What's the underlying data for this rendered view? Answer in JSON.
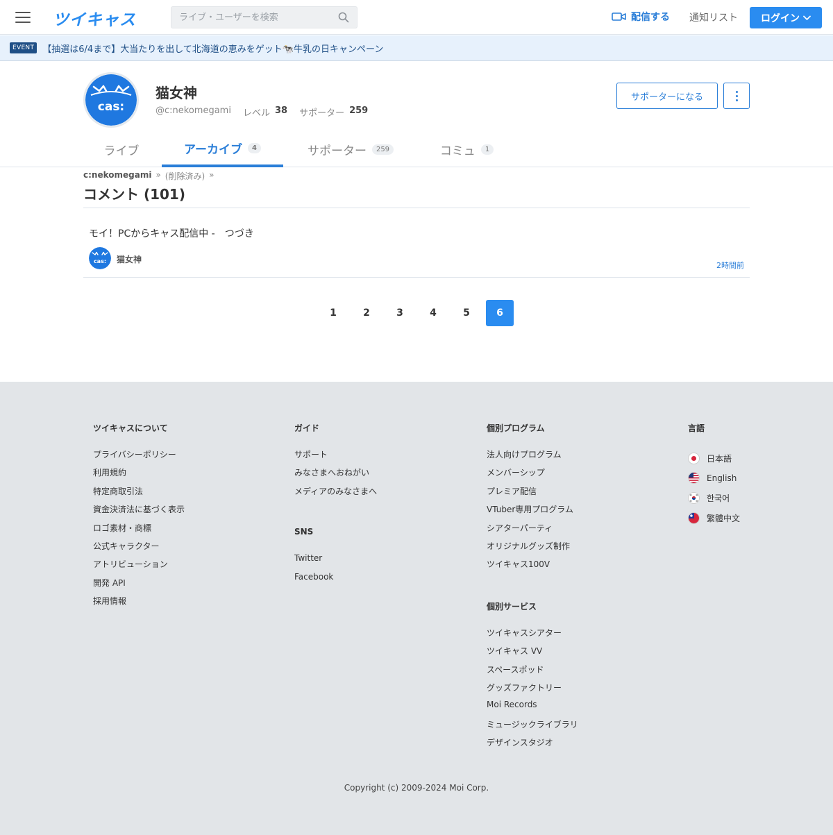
{
  "header": {
    "logo": "ツイキャス",
    "search_placeholder": "ライブ・ユーザーを検索",
    "broadcast_label": "配信する",
    "notify_label": "通知リスト",
    "login_label": "ログイン"
  },
  "event": {
    "badge": "EVENT",
    "text": "【抽選は6/4まで】大当たりを出して北海道の恵みをゲット🐄牛乳の日キャンペーン"
  },
  "profile": {
    "name": "猫女神",
    "handle": "@c:nekomegami",
    "level_label": "レベル",
    "level": "38",
    "supporter_label": "サポーター",
    "supporter_count": "259",
    "become_supporter": "サポーターになる"
  },
  "tabs": [
    {
      "label": "ライブ",
      "count": ""
    },
    {
      "label": "アーカイブ",
      "count": "4"
    },
    {
      "label": "サポーター",
      "count": "259"
    },
    {
      "label": "コミュ",
      "count": "1"
    }
  ],
  "breadcrumb": {
    "user": "c:nekomegami",
    "sep1": "»",
    "deleted": "(削除済み)",
    "sep2": "»"
  },
  "comments": {
    "title": "コメント (101)",
    "items": [
      {
        "text": "モイ！PCからキャス配信中 -　つづき",
        "user": "猫女神",
        "time": "2時間前"
      }
    ]
  },
  "pagination": {
    "pages": [
      "1",
      "2",
      "3",
      "4",
      "5",
      "6"
    ],
    "current": "6"
  },
  "footer": {
    "about": {
      "title": "ツイキャスについて",
      "items": [
        "プライバシーポリシー",
        "利用規約",
        "特定商取引法",
        "資金決済法に基づく表示",
        "ロゴ素材・商標",
        "公式キャラクター",
        "アトリビューション",
        "開発 API",
        "採用情報"
      ]
    },
    "guide": {
      "title": "ガイド",
      "items": [
        "サポート",
        "みなさまへおねがい",
        "メディアのみなさまへ"
      ]
    },
    "sns": {
      "title": "SNS",
      "items": [
        "Twitter",
        "Facebook"
      ]
    },
    "programs": {
      "title": "個別プログラム",
      "items": [
        "法人向けプログラム",
        "メンバーシップ",
        "プレミア配信",
        "VTuber専用プログラム",
        "シアターパーティ",
        "オリジナルグッズ制作",
        "ツイキャス100V"
      ]
    },
    "services": {
      "title": "個別サービス",
      "items": [
        "ツイキャスシアター",
        "ツイキャス VV",
        "スペースポッド",
        "グッズファクトリー",
        "Moi Records",
        "ミュージックライブラリ",
        "デザインスタジオ"
      ]
    },
    "language": {
      "title": "言語",
      "items": [
        "日本語",
        "English",
        "한국어",
        "繁體中文"
      ]
    },
    "copyright": "Copyright (c) 2009-2024 Moi Corp."
  },
  "colors": {
    "brand": "#2a8cf0",
    "accent": "#2a7ed8",
    "footer_bg": "#e2e5e8"
  }
}
